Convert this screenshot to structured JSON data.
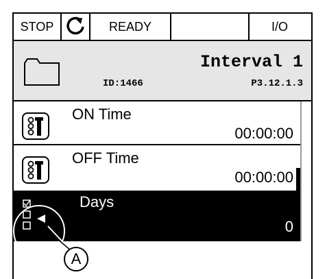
{
  "status_bar": {
    "stop": "STOP",
    "icon": "rotate-icon",
    "ready": "READY",
    "empty": "",
    "io": "I/O"
  },
  "header": {
    "title": "Interval 1",
    "id": "ID:1466",
    "path": "P3.12.1.3",
    "icon": "folder-icon"
  },
  "rows": [
    {
      "label": "ON Time",
      "value": "00:00:00",
      "icon": "parameter-icon"
    },
    {
      "label": "OFF Time",
      "value": "00:00:00",
      "icon": "parameter-icon"
    },
    {
      "label": "Days",
      "value": "0",
      "icon": "checkbox-list-icon",
      "selected": true
    }
  ],
  "callout": {
    "label": "A"
  }
}
